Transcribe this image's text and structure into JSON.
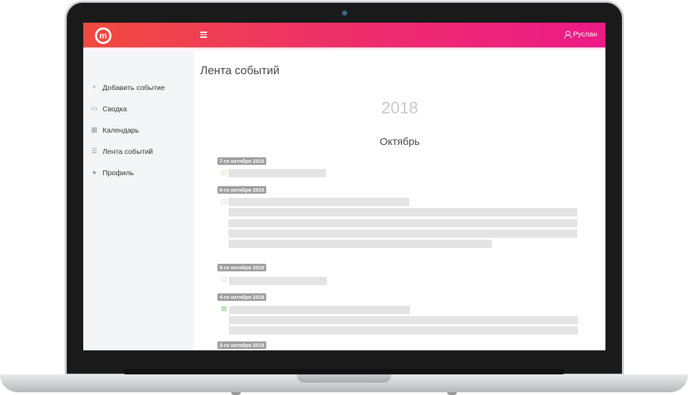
{
  "header": {
    "user_name": "Руслан"
  },
  "sidebar": {
    "items": [
      {
        "label": "Добавить событие",
        "icon": "plus-icon"
      },
      {
        "label": "Сводка",
        "icon": "id-card-icon"
      },
      {
        "label": "Календарь",
        "icon": "calendar-icon"
      },
      {
        "label": "Лента событий",
        "icon": "list-icon"
      },
      {
        "label": "Профиль",
        "icon": "user-icon"
      }
    ]
  },
  "main": {
    "title": "Лента событий",
    "year": "2018",
    "month": "Октябрь",
    "dates": [
      "7-го октября 2018",
      "6-го октября 2018",
      "5-го октября 2018",
      "4-го октября 2018",
      "3-го октября 2018"
    ]
  },
  "colors": {
    "header_start": "#f04b3f",
    "header_end": "#ec1a86",
    "sidebar_bg": "#f4f5f7",
    "badge": "#9e9e9e"
  }
}
